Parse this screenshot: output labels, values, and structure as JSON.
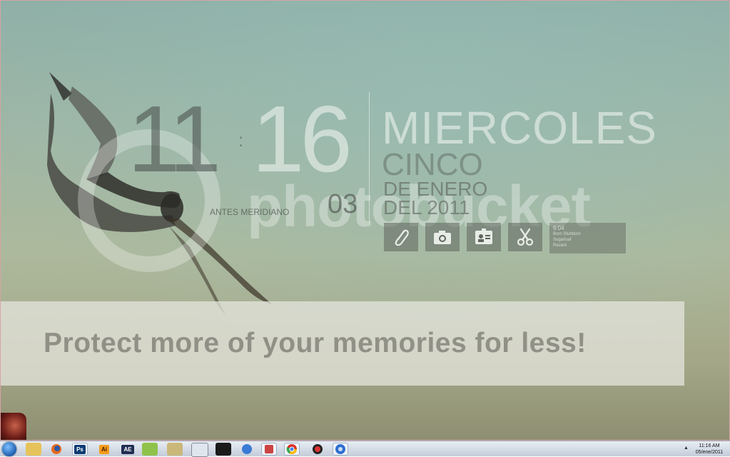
{
  "clock": {
    "hours": "11",
    "separator": ":",
    "minutes": "16",
    "seconds": "03",
    "ampm": "ANTES MERIDIANO"
  },
  "date": {
    "weekday": "MIERCOLES",
    "day": "CINCO",
    "month": "DE ENERO",
    "year": "DEL 2011"
  },
  "dock": {
    "icons": [
      "paperclip-icon",
      "camera-icon",
      "contact-card-icon",
      "scissors-icon"
    ],
    "panel": {
      "time": "6:04",
      "lines": [
        "Born Stubborn",
        "Sugarloaf",
        "Recent"
      ]
    }
  },
  "watermark": {
    "brand": "photobucket",
    "banner": "Protect more of your memories for less!"
  },
  "taskbar": {
    "apps": [
      "explorer",
      "firefox",
      "Ps",
      "Ai",
      "AE",
      "app",
      "app",
      "app",
      "app",
      "app",
      "app",
      "app",
      "chrome",
      "app",
      "itunes"
    ],
    "clock_time": "11:16 AM",
    "clock_date": "05/ene/2011"
  },
  "colors": {
    "taskbar": "#d5dde7",
    "accent_blue": "#1d5fb0"
  }
}
